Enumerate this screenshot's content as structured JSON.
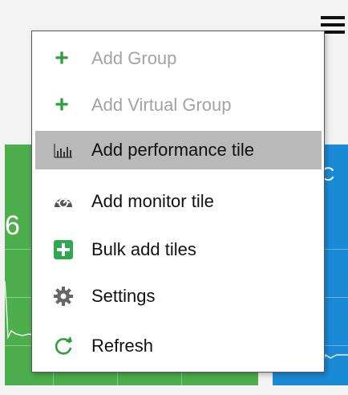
{
  "background": {
    "tile_value_partial": "6",
    "tile_blue_label_partial": "C"
  },
  "menu": {
    "items": [
      {
        "label": "Add Group",
        "icon": "plus-icon",
        "disabled": true
      },
      {
        "label": "Add Virtual Group",
        "icon": "plus-icon",
        "disabled": true
      },
      {
        "label": "Add performance tile",
        "icon": "bar-chart-icon",
        "selected": true
      },
      {
        "label": "Add monitor tile",
        "icon": "gauge-icon"
      },
      {
        "label": "Bulk add tiles",
        "icon": "plus-square-icon"
      },
      {
        "label": "Settings",
        "icon": "gear-icon"
      },
      {
        "label": "Refresh",
        "icon": "refresh-icon"
      }
    ]
  },
  "colors": {
    "accent_green": "#2e9e3e",
    "tile_green": "#4cae4c",
    "tile_blue": "#1b8ad6",
    "selected_bg": "#b9b9b9",
    "disabled_text": "#a3a3a3"
  }
}
